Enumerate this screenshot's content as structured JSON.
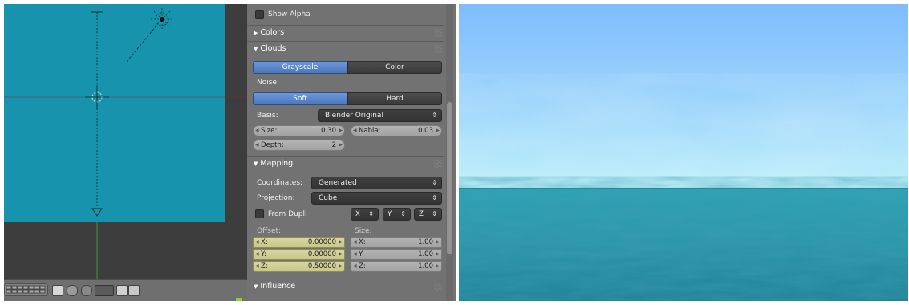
{
  "properties": {
    "show_alpha_label": "Show Alpha",
    "colors_header": "Colors",
    "clouds_header": "Clouds",
    "grayscale_label": "Grayscale",
    "color_label": "Color",
    "noise_label": "Noise:",
    "soft_label": "Soft",
    "hard_label": "Hard",
    "basis_label": "Basis:",
    "basis_value": "Blender Original",
    "size_label": "Size:",
    "size_value": "0.30",
    "nabla_label": "Nabla:",
    "nabla_value": "0.03",
    "depth_label": "Depth:",
    "depth_value": "2",
    "mapping_header": "Mapping",
    "coordinates_label": "Coordinates:",
    "coordinates_value": "Generated",
    "projection_label": "Projection:",
    "projection_value": "Cube",
    "from_dupli_label": "From Dupli",
    "axis_x": "X",
    "axis_y": "Y",
    "axis_z": "Z",
    "offset_label": "Offset:",
    "size2_label": "Size:",
    "offset_x_label": "X:",
    "offset_x_value": "0.00000",
    "offset_y_label": "Y:",
    "offset_y_value": "0.00000",
    "offset_z_label": "Z:",
    "offset_z_value": "0.50000",
    "scale_x_label": "X:",
    "scale_x_value": "1.00",
    "scale_y_label": "Y:",
    "scale_y_value": "1.00",
    "scale_z_label": "Z:",
    "scale_z_value": "1.00",
    "influence_header": "Influence"
  },
  "colors": {
    "viewport_camera_bg": "#1893ad",
    "panel_bg": "#727272",
    "selected_blue": "#5a86cc",
    "highlight_yellow": "#d3d096",
    "sky_top": "#7ebcff",
    "sky_horizon": "#bdf0fa",
    "water": "#2a9fb0"
  },
  "icons": [
    "view-menu-icon",
    "layer-grid-icon",
    "render-icon",
    "snap-icon",
    "camera-icon",
    "sun-lamp-icon",
    "triangle-marker-icon"
  ]
}
